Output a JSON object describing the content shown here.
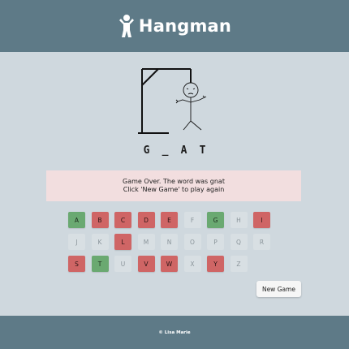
{
  "header": {
    "logo_icon": "stick-figure-icon",
    "title": "Hangman"
  },
  "word": {
    "letters": [
      "G",
      "_",
      "A",
      "T"
    ]
  },
  "message": {
    "line1": "Game Over. The word was gnat",
    "line2": "Click 'New Game' to play again"
  },
  "keyboard": {
    "keys": [
      {
        "letter": "A",
        "state": "correct"
      },
      {
        "letter": "B",
        "state": "wrong"
      },
      {
        "letter": "C",
        "state": "wrong"
      },
      {
        "letter": "D",
        "state": "wrong"
      },
      {
        "letter": "E",
        "state": "wrong"
      },
      {
        "letter": "F",
        "state": "unused"
      },
      {
        "letter": "G",
        "state": "correct"
      },
      {
        "letter": "H",
        "state": "unused"
      },
      {
        "letter": "I",
        "state": "wrong"
      },
      {
        "letter": "J",
        "state": "unused"
      },
      {
        "letter": "K",
        "state": "unused"
      },
      {
        "letter": "L",
        "state": "wrong"
      },
      {
        "letter": "M",
        "state": "unused"
      },
      {
        "letter": "N",
        "state": "unused"
      },
      {
        "letter": "O",
        "state": "unused"
      },
      {
        "letter": "P",
        "state": "unused"
      },
      {
        "letter": "Q",
        "state": "unused"
      },
      {
        "letter": "R",
        "state": "unused"
      },
      {
        "letter": "S",
        "state": "wrong"
      },
      {
        "letter": "T",
        "state": "correct"
      },
      {
        "letter": "U",
        "state": "unused"
      },
      {
        "letter": "V",
        "state": "wrong"
      },
      {
        "letter": "W",
        "state": "wrong"
      },
      {
        "letter": "X",
        "state": "unused"
      },
      {
        "letter": "Y",
        "state": "wrong"
      },
      {
        "letter": "Z",
        "state": "unused"
      }
    ]
  },
  "controls": {
    "new_game_label": "New Game"
  },
  "footer": {
    "credit": "© Lisa Marie"
  },
  "colors": {
    "header_bg": "#5e7a87",
    "page_bg": "#cfd8de",
    "correct": "#6aa971",
    "wrong": "#cf6565",
    "unused": "#d8dfe3",
    "message_bg": "#f2dedf"
  }
}
